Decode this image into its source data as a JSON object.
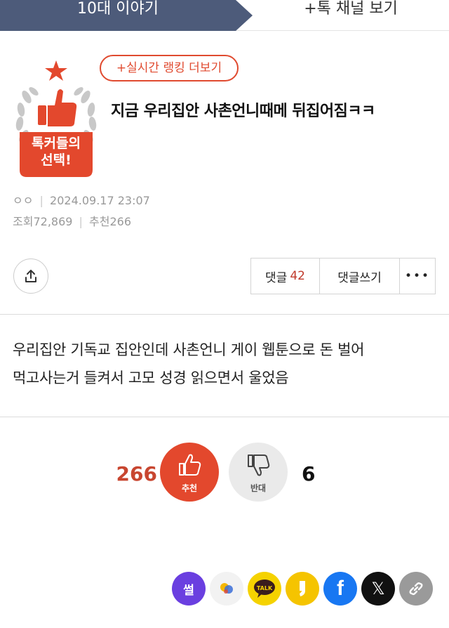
{
  "tabs": {
    "active": "10대 이야기",
    "channel": "+톡 채널 보기"
  },
  "badge": {
    "line1": "톡커들의",
    "line2": "선택!"
  },
  "ranking_button": "+실시간 랭킹 더보기",
  "post": {
    "title": "지금 우리집안 사촌언니때메 뒤집어짐ㅋㅋ",
    "author": "ㅇㅇ",
    "date": "2024.09.17 23:07",
    "views_label": "조회",
    "views": "72,869",
    "recommend_label": "추천",
    "recommend_count": "266",
    "body_line1": "우리집안 기독교 집안인데 사촌언니 게이 웹툰으로 돈 벌어",
    "body_line2": "먹고사는거 들켜서 고모 성경 읽으면서 울었음"
  },
  "actions": {
    "comments_label": "댓글",
    "comments_count": "42",
    "write_comment": "댓글쓰기",
    "more": "•••"
  },
  "vote": {
    "up_count": "266",
    "up_label": "추천",
    "down_label": "반대",
    "down_count": "6"
  },
  "share": {
    "ssul": "썰",
    "talk": "TALK",
    "facebook": "f",
    "x": "𝕏"
  },
  "colors": {
    "tab": "#4d5b7a",
    "accent": "#e3482d",
    "facebook": "#1877f2",
    "kakao": "#f5d200",
    "ssul": "#6a3fe0"
  }
}
